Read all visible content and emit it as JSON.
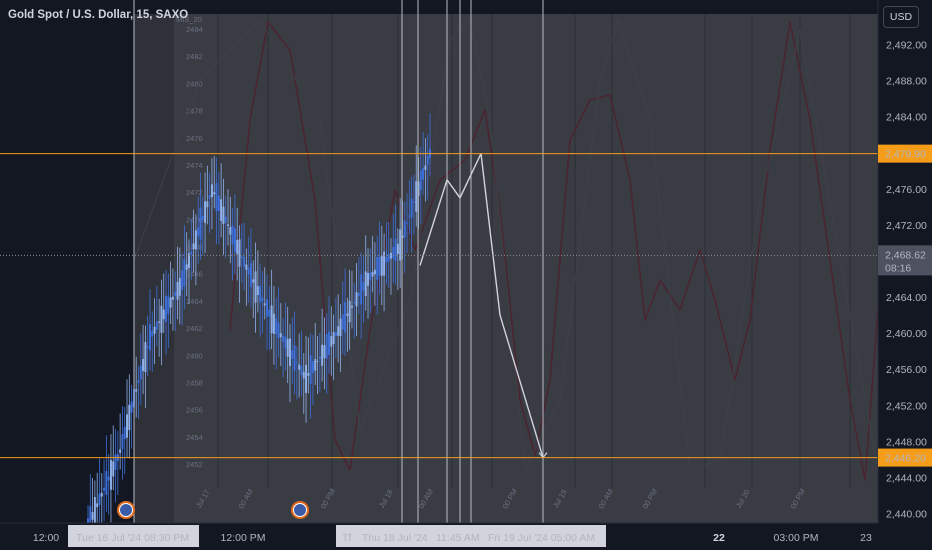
{
  "header": {
    "title": "Gold Spot / U.S. Dollar, 15, SAXO",
    "currency": "USD"
  },
  "colors": {
    "background": "#131722",
    "panel": "#3a3c44",
    "candle": "#3d6fd9",
    "projection": "#d1d4dc",
    "wave": "#4a2530",
    "level_line": "#f59d19",
    "price_tag": "#f59d19",
    "current_tag": "#4e5260"
  },
  "price_axis": {
    "ticks": [
      "2,492.00",
      "2,488.00",
      "2,484.00",
      "2,480.00",
      "2,476.00",
      "2,472.00",
      "2,468.00",
      "2,464.00",
      "2,460.00",
      "2,456.00",
      "2,452.00",
      "2,448.00",
      "2,444.00",
      "2,440.00"
    ],
    "levels": [
      {
        "label": "2,479.90",
        "price": 2479.9
      },
      {
        "label": "2,446.20",
        "price": 2446.2
      }
    ],
    "current": {
      "label": "2,468.62",
      "price": 2468.62,
      "countdown": "08:16"
    }
  },
  "time_axis": {
    "ticks": [
      {
        "label": "12:00",
        "bold": false
      },
      {
        "label": "12:00 PM",
        "bold": false
      },
      {
        "label": "22",
        "bold": true
      },
      {
        "label": "03:00 PM",
        "bold": false
      },
      {
        "label": "23",
        "bold": false
      }
    ],
    "markers": [
      {
        "label": "Tue 16 Jul '24   08:30 PM"
      },
      {
        "label": "Tf"
      },
      {
        "label": "Thu 18 Jul '24"
      },
      {
        "label": "11:45 AM"
      },
      {
        "label": "Fri 19 Jul '24   05:00 AM"
      }
    ]
  },
  "inner_chart": {
    "title": "MIS_20",
    "yticks": [
      "2484",
      "2482",
      "2480",
      "2478",
      "2476",
      "2474",
      "2472",
      "2470",
      "2468",
      "2466",
      "2464",
      "2462",
      "2460",
      "2458",
      "2456",
      "2454",
      "2452"
    ],
    "xticks": [
      "Jul 17",
      "00 AM",
      "00 PM",
      "Jul 18",
      "00 AM",
      "00 PM",
      "Jul 19",
      "00 AM",
      "00 PM",
      "Jul 20",
      "00 PM"
    ]
  },
  "chart_data": {
    "type": "line",
    "title": "Gold Spot / U.S. Dollar, 15, SAXO",
    "ylim": [
      2438.6,
      2495.6
    ],
    "grid": false,
    "price_scale": "right",
    "horizontal_levels": [
      2479.9,
      2446.2
    ],
    "current_price": 2468.62,
    "series": [
      {
        "x": [
          "Tue 16 Jul '24 08:30 PM",
          "",
          "",
          "",
          "",
          "",
          "",
          "",
          "Thu 18 Jul '24",
          "11:45 AM",
          "",
          "Fri 19 Jul '24 05:00 AM"
        ],
        "values": [
          2438.6,
          2446.5,
          2459.5,
          2465.5,
          2476.0,
          2468.0,
          2461.0,
          2455.0,
          2460.0,
          2466.0,
          2469.5,
          2479.9
        ]
      },
      {
        "x": [
          "",
          "",
          "",
          "",
          "",
          ""
        ],
        "values": [
          2467.5,
          2477.0,
          2475.0,
          2479.9,
          2462.0,
          2446.2
        ]
      }
    ]
  }
}
